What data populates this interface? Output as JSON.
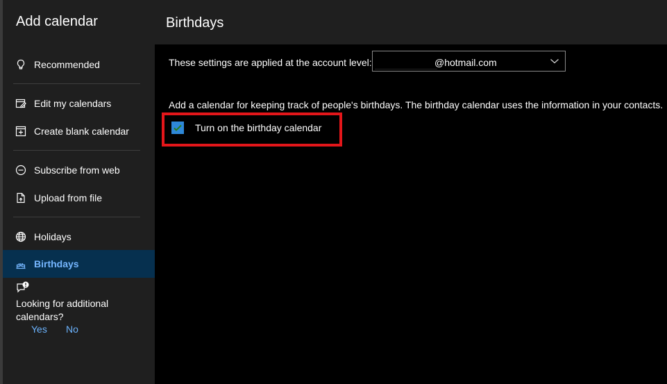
{
  "sidebar": {
    "title": "Add calendar",
    "items": [
      {
        "label": "Recommended",
        "icon": "lightbulb-icon"
      },
      {
        "label": "Edit my calendars",
        "icon": "edit-calendar-icon"
      },
      {
        "label": "Create blank calendar",
        "icon": "add-calendar-icon"
      },
      {
        "label": "Subscribe from web",
        "icon": "web-subscribe-icon"
      },
      {
        "label": "Upload from file",
        "icon": "file-upload-icon"
      },
      {
        "label": "Holidays",
        "icon": "globe-icon"
      },
      {
        "label": "Birthdays",
        "icon": "birthday-cake-icon",
        "active": true
      }
    ],
    "feedback": {
      "icon": "feedback-icon",
      "text": "Looking for additional calendars?",
      "yes": "Yes",
      "no": "No"
    }
  },
  "main": {
    "title": "Birthdays",
    "account_label": "These settings are applied at the account level:",
    "account_value": "@hotmail.com",
    "description": "Add a calendar for keeping track of people's birthdays. The birthday calendar uses the information in your contacts.",
    "checkbox_label": "Turn on the birthday calendar",
    "checkbox_checked": true
  },
  "colors": {
    "accent": "#75b6ff",
    "active_bg": "#06304f",
    "highlight": "#e3161a",
    "checkbox": "#2e88d8"
  }
}
